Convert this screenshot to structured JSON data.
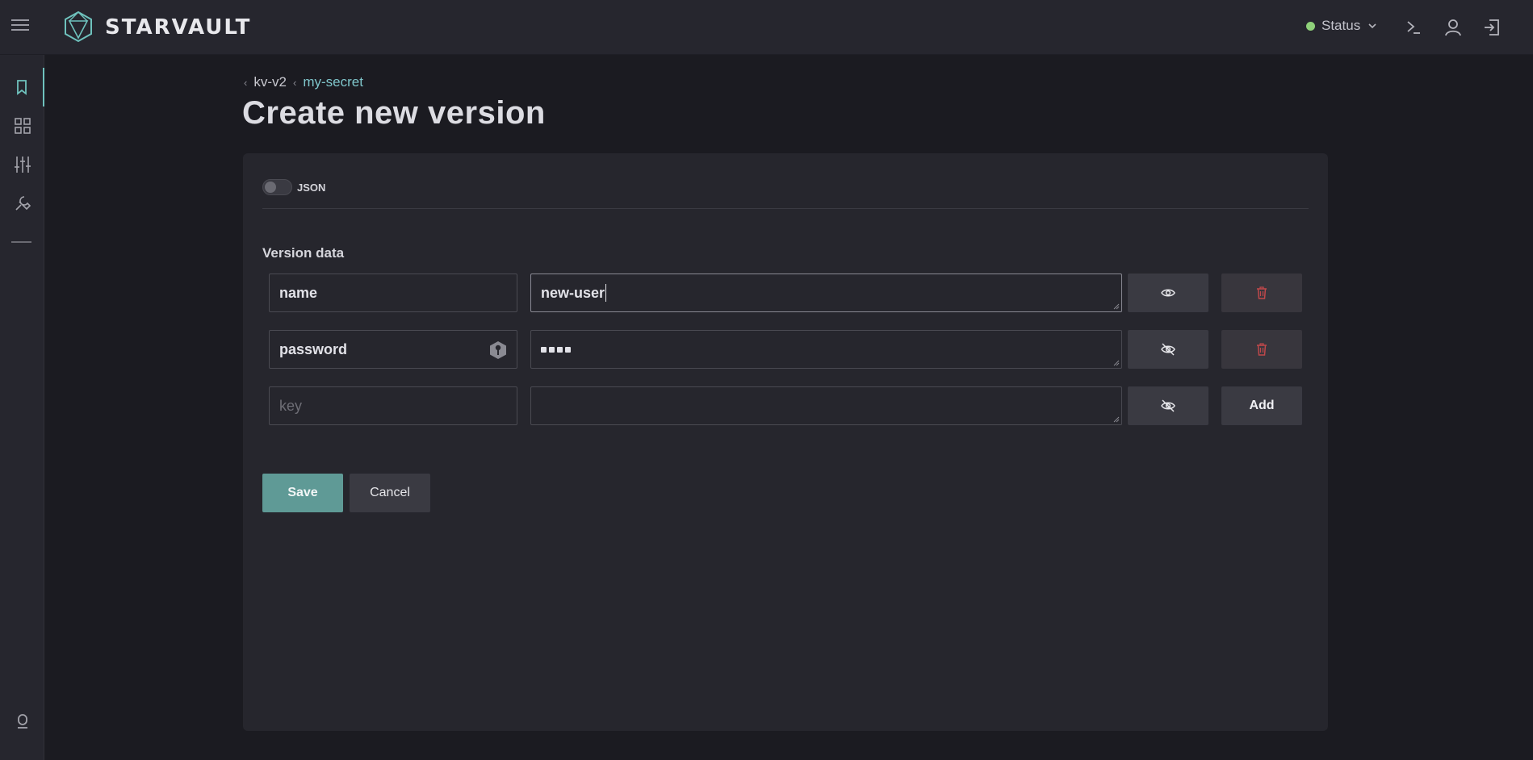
{
  "app": {
    "brand": "STARVAULT"
  },
  "header": {
    "status_label": "Status",
    "status_color": "#8fd17a"
  },
  "breadcrumb": {
    "items": [
      "kv-v2",
      "my-secret"
    ]
  },
  "page": {
    "title": "Create new version"
  },
  "form": {
    "json_toggle_label": "JSON",
    "json_toggle_on": false,
    "section_label": "Version data",
    "rows": [
      {
        "key": "name",
        "value": "new-user",
        "value_visible": true
      },
      {
        "key": "password",
        "value": "••••",
        "value_visible": false
      }
    ],
    "new_row": {
      "key_placeholder": "key",
      "value": "",
      "add_label": "Add"
    },
    "save_label": "Save",
    "cancel_label": "Cancel"
  },
  "colors": {
    "accent": "#6fc2bd",
    "primary_button": "#5f9a96",
    "danger": "#d9534f",
    "background": "#1b1b21",
    "surface": "#26262d"
  },
  "icons": [
    "menu-icon",
    "logo-icon",
    "chevron-down-icon",
    "terminal-icon",
    "user-icon",
    "logout-icon",
    "bookmark-icon",
    "grid-icon",
    "sliders-icon",
    "wrench-icon",
    "minus-icon",
    "bulb-icon",
    "key-icon",
    "eye-icon",
    "eye-off-icon",
    "trash-icon"
  ]
}
